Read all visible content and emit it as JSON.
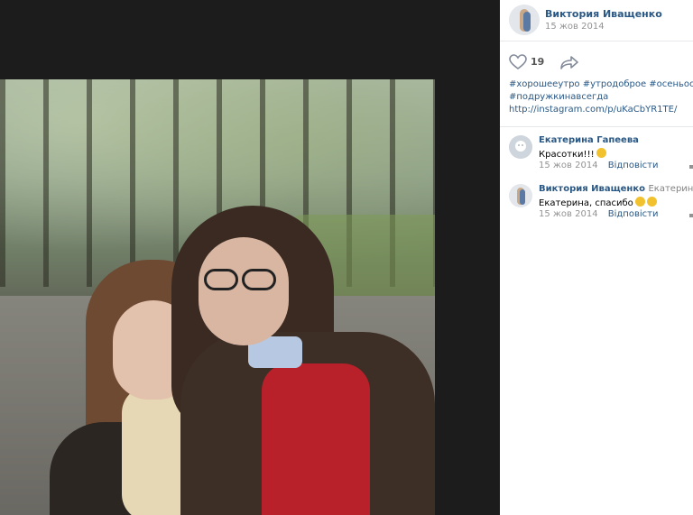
{
  "post": {
    "author": "Виктория Иващенко",
    "date": "15 жов 2014",
    "likes": "19",
    "hashtags_line1": "#хорошееутро #утродоброе #осеньосень",
    "hashtags_line2": "#подружкинавсегда",
    "link": "http://instagram.com/p/uKaCbYR1TE/"
  },
  "comments": [
    {
      "author": "Екатерина Гапеева",
      "reply_to": "",
      "text": "Красотки!!!",
      "date": "15 жов 2014",
      "reply_label": "Відповісти"
    },
    {
      "author": "Виктория Иващенко",
      "reply_to": "Екатерині",
      "text": "Екатерина, спасибо",
      "date": "15 жов 2014",
      "reply_label": "Відповісти"
    }
  ],
  "icons": {
    "like": "heart-icon",
    "share": "share-arrow-icon"
  },
  "colors": {
    "link": "#2a5885",
    "muted": "#939393",
    "background_dark": "#1a1a1a"
  }
}
